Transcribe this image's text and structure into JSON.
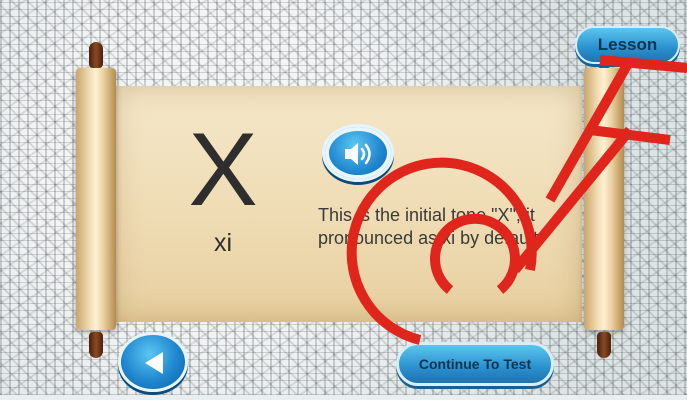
{
  "header": {
    "lesson_label": "Lesson"
  },
  "card": {
    "letter": "X",
    "pinyin": "xi",
    "description": "This is the initial tone \"X\", it pronounced as xi by default."
  },
  "footer": {
    "continue_label": "Continue To Test"
  },
  "icons": {
    "speaker": "speaker-icon",
    "back": "back-arrow-icon"
  },
  "colors": {
    "button_blue": "#2a8fcf",
    "paper": "#efdcb4",
    "roller_wood": "#8a4a22"
  }
}
